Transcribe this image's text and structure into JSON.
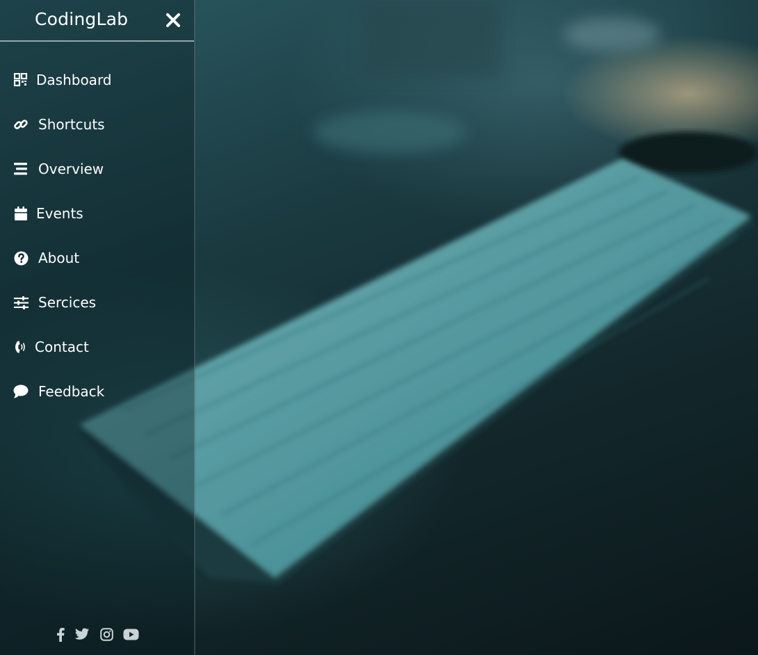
{
  "sidebar": {
    "logo": "CodingLab",
    "items": [
      {
        "label": "Dashboard",
        "icon": "dashboard-grid-icon"
      },
      {
        "label": "Shortcuts",
        "icon": "link-icon"
      },
      {
        "label": "Overview",
        "icon": "stream-lines-icon"
      },
      {
        "label": "Events",
        "icon": "calendar-icon"
      },
      {
        "label": "About",
        "icon": "question-circle-icon"
      },
      {
        "label": "Sercices",
        "icon": "sliders-icon"
      },
      {
        "label": "Contact",
        "icon": "phone-volume-icon"
      },
      {
        "label": "Feedback",
        "icon": "comment-icon"
      }
    ],
    "social": [
      "facebook-icon",
      "twitter-icon",
      "instagram-icon",
      "youtube-icon"
    ]
  },
  "colors": {
    "text": "#ffffff",
    "sidebar_tint": "#081e22",
    "accent_teal": "#3f8f98"
  }
}
